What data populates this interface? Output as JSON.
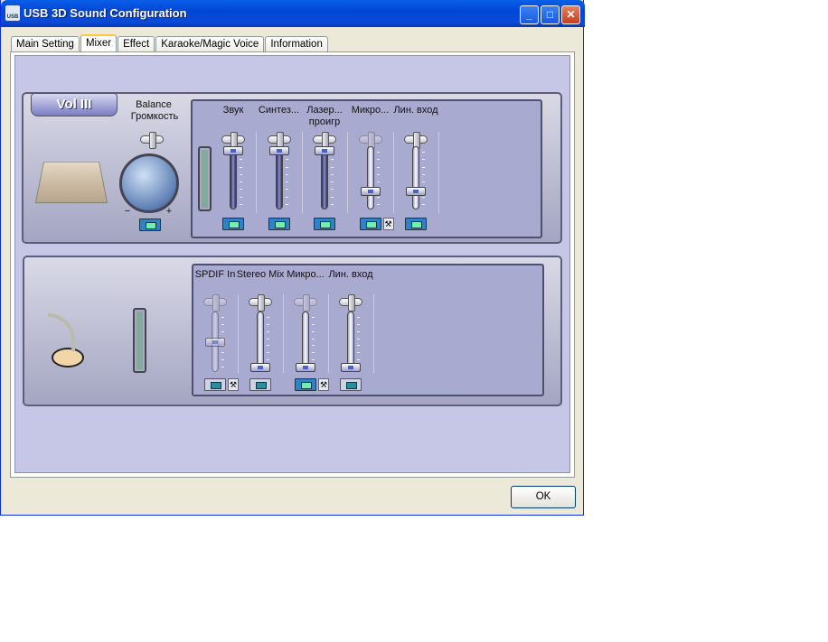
{
  "window": {
    "title": "USB 3D Sound Configuration",
    "icon_text": "USB",
    "buttons": {
      "minimize": "_",
      "maximize": "□",
      "close": "✕"
    }
  },
  "tabs": [
    {
      "label": "Main Setting",
      "active": false
    },
    {
      "label": "Mixer",
      "active": true
    },
    {
      "label": "Effect",
      "active": false
    },
    {
      "label": "Karaoke/Magic Voice",
      "active": false
    },
    {
      "label": "Information",
      "active": false
    }
  ],
  "playback": {
    "vol_badge": "Vol III",
    "balance_label": "Balance",
    "volume_label": "Громкость",
    "knob_minus": "−",
    "knob_plus": "+",
    "channels": [
      {
        "label": "Звук",
        "volume": 100,
        "enabled": true,
        "mute_on": true,
        "advanced": false
      },
      {
        "label": "Синтез...",
        "volume": 100,
        "enabled": true,
        "mute_on": true,
        "advanced": false
      },
      {
        "label": "Лазер... проигр",
        "volume": 100,
        "enabled": true,
        "mute_on": true,
        "advanced": false
      },
      {
        "label": "Микро...",
        "volume": 25,
        "enabled": true,
        "balance_disabled": true,
        "mute_on": true,
        "advanced": true
      },
      {
        "label": "Лин. вход",
        "volume": 25,
        "enabled": true,
        "mute_on": true,
        "advanced": false
      }
    ]
  },
  "recording": {
    "channels": [
      {
        "label": "SPDIF In",
        "volume": 50,
        "enabled": false,
        "mute_on": false,
        "advanced": true
      },
      {
        "label": "Stereo Mix",
        "volume": 0,
        "enabled": true,
        "mute_on": false,
        "advanced": false
      },
      {
        "label": "Микро...",
        "volume": 0,
        "enabled": true,
        "balance_disabled": true,
        "mute_on": true,
        "advanced": true
      },
      {
        "label": "Лин. вход",
        "volume": 0,
        "enabled": true,
        "mute_on": false,
        "advanced": false
      }
    ]
  },
  "ok_label": "OK",
  "advanced_icon": "⚒"
}
